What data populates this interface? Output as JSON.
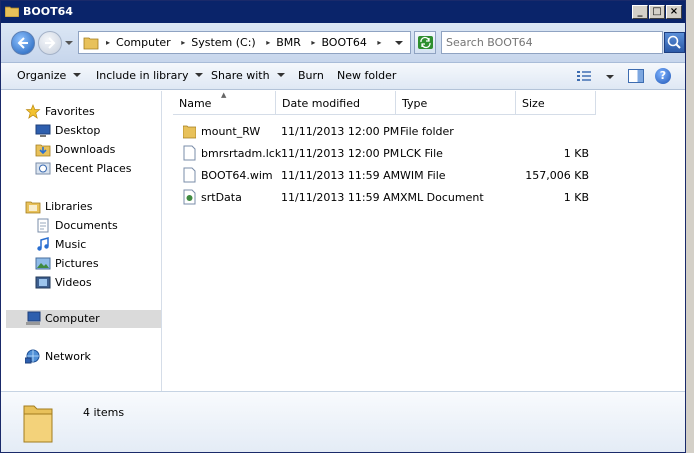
{
  "window": {
    "title": "BOOT64"
  },
  "titlebar_buttons": {
    "minimize": "_",
    "maximize": "□",
    "close": "×"
  },
  "navigation": {
    "breadcrumbs": [
      "Computer",
      "System (C:)",
      "BMR",
      "BOOT64"
    ],
    "search_placeholder": "Search BOOT64"
  },
  "toolbar": {
    "organize": "Organize",
    "include_in_library": "Include in library",
    "share_with": "Share with",
    "burn": "Burn",
    "new_folder": "New folder",
    "help": "?"
  },
  "sidebar": {
    "favorites": {
      "label": "Favorites",
      "items": [
        "Desktop",
        "Downloads",
        "Recent Places"
      ]
    },
    "libraries": {
      "label": "Libraries",
      "items": [
        "Documents",
        "Music",
        "Pictures",
        "Videos"
      ]
    },
    "computer": "Computer",
    "network": "Network"
  },
  "columns": {
    "name": "Name",
    "date_modified": "Date modified",
    "type": "Type",
    "size": "Size"
  },
  "files": [
    {
      "name": "mount_RW",
      "date": "11/11/2013 12:00 PM",
      "type": "File folder",
      "size": "",
      "icon": "folder-icon"
    },
    {
      "name": "bmrsrtadm.lck",
      "date": "11/11/2013 12:00 PM",
      "type": "LCK File",
      "size": "1 KB",
      "icon": "file-icon"
    },
    {
      "name": "BOOT64.wim",
      "date": "11/11/2013 11:59 AM",
      "type": "WIM File",
      "size": "157,006 KB",
      "icon": "file-icon"
    },
    {
      "name": "srtData",
      "date": "11/11/2013 11:59 AM",
      "type": "XML Document",
      "size": "1 KB",
      "icon": "xml-file-icon"
    }
  ],
  "details": {
    "item_count": "4 items"
  },
  "colors": {
    "titlebar": "#0a246a",
    "selection": "#dadada",
    "folder": "#e8c15a"
  }
}
